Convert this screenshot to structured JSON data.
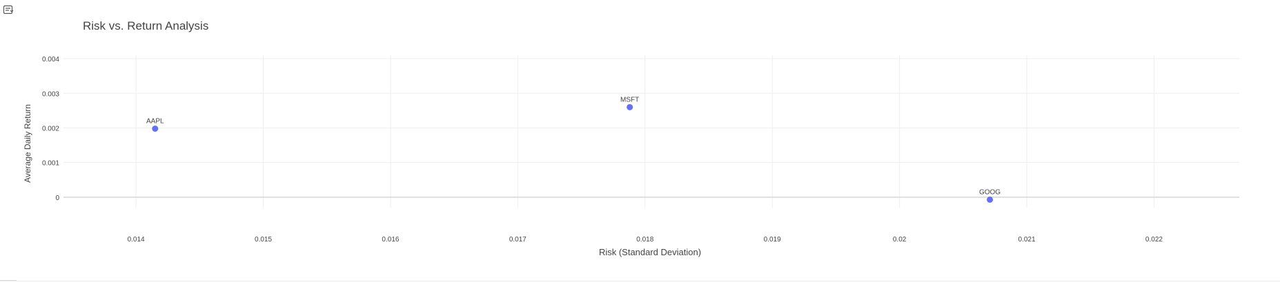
{
  "toolbar": {
    "icon": "toggle-panel-icon"
  },
  "chart_data": {
    "type": "scatter",
    "title": "Risk vs. Return Analysis",
    "xlabel": "Risk (Standard Deviation)",
    "ylabel": "Average Daily Return",
    "xlim": [
      0.01343,
      0.02267
    ],
    "ylim": [
      -0.0006,
      0.0043
    ],
    "x_ticks": [
      0.014,
      0.015,
      0.016,
      0.017,
      0.018,
      0.019,
      0.02,
      0.021,
      0.022
    ],
    "x_tick_labels": [
      "0.014",
      "0.015",
      "0.016",
      "0.017",
      "0.018",
      "0.019",
      "0.02",
      "0.021",
      "0.022"
    ],
    "y_ticks": [
      0,
      0.001,
      0.002,
      0.003,
      0.004
    ],
    "y_tick_labels": [
      "0",
      "0.001",
      "0.002",
      "0.003",
      "0.004"
    ],
    "grid": true,
    "marker_color": "#636efa",
    "points": [
      {
        "label": "AAPL",
        "x": 0.01415,
        "y": 0.00198
      },
      {
        "label": "MSFT",
        "x": 0.01788,
        "y": 0.0026
      },
      {
        "label": "GOOG",
        "x": 0.02071,
        "y": -7e-05
      }
    ]
  }
}
